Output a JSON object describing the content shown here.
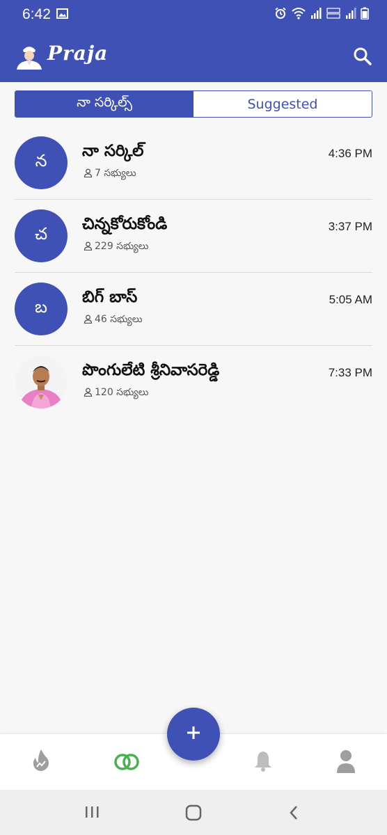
{
  "status_bar": {
    "time": "6:42"
  },
  "app_bar": {
    "title": "Praja"
  },
  "tabs": [
    {
      "label": "నా సర్కిల్స్",
      "active": true
    },
    {
      "label": "Suggested",
      "active": false
    }
  ],
  "circles": [
    {
      "initial": "న",
      "name": "నా సర్కిల్",
      "members": "7 సభ్యులు",
      "time": "4:36 PM"
    },
    {
      "initial": "చ",
      "name": "చిన్నకోరుకోండి",
      "members": "229 సభ్యులు",
      "time": "3:37 PM"
    },
    {
      "initial": "బ",
      "name": "బిగ్ బాస్",
      "members": "46 సభ్యులు",
      "time": "5:05 AM"
    },
    {
      "initial": "",
      "name": "పొంగులేటి శ్రీనివాసరెడ్డి",
      "members": "120 సభ్యులు",
      "time": "7:33 PM"
    }
  ],
  "fab": {
    "label": "+"
  },
  "colors": {
    "primary": "#3f51b5",
    "active_nav": "#4caf50",
    "inactive_nav": "#9e9e9e"
  }
}
